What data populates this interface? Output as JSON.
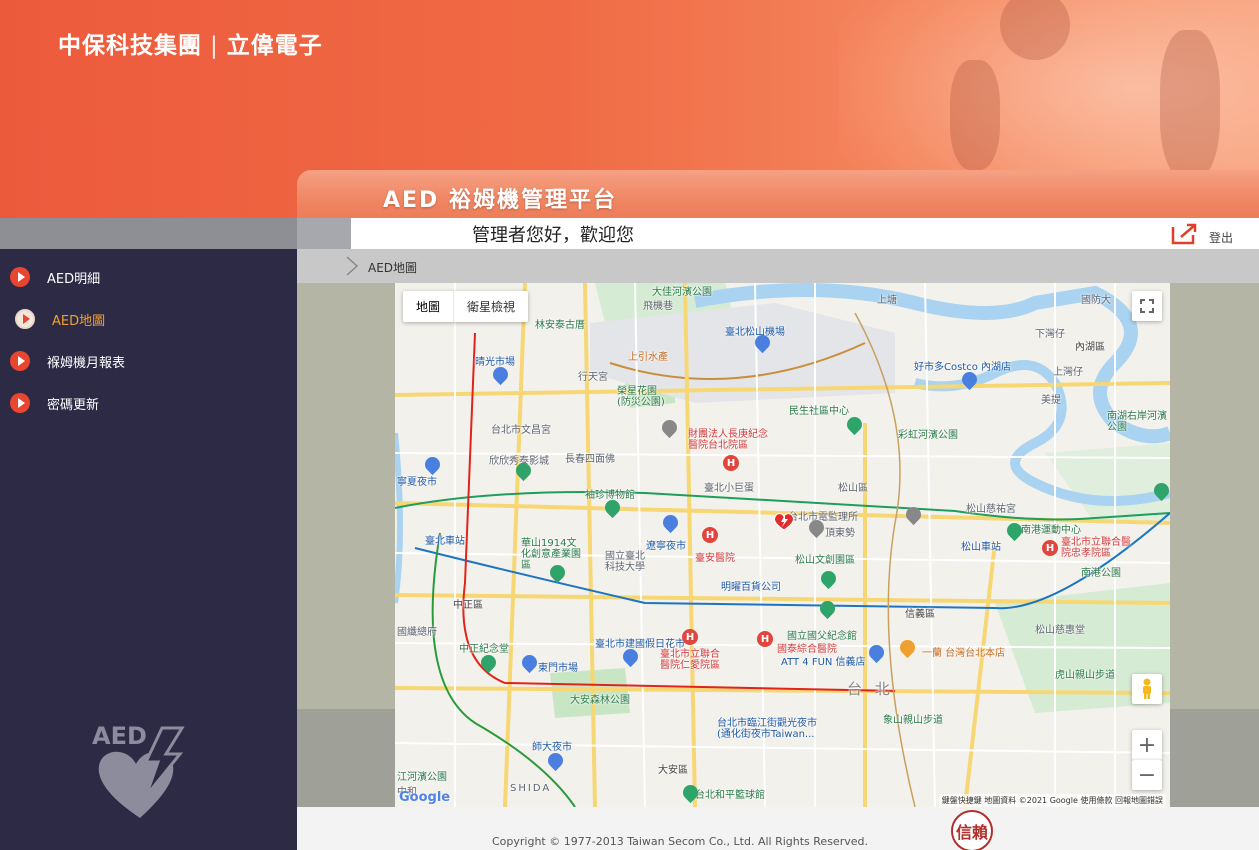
{
  "header": {
    "brand_left": "中保科技集團",
    "brand_sep": "|",
    "brand_right": "立偉電子",
    "platform_title": "AED 裕姆機管理平台"
  },
  "topbar": {
    "welcome": "管理者您好，歡迎您",
    "logout": "登出"
  },
  "breadcrumb": "AED地圖",
  "sidebar": {
    "items": [
      {
        "label": "AED明細",
        "active": false
      },
      {
        "label": "AED地圖",
        "active": true
      },
      {
        "label": "褓姆機月報表",
        "active": false
      },
      {
        "label": "密碼更新",
        "active": false
      }
    ],
    "logo_text": "AED"
  },
  "map": {
    "type_map": "地圖",
    "type_satellite": "衛星檢視",
    "zoom_in": "+",
    "zoom_out": "−",
    "google": "Google",
    "attribution": "鍵盤快捷鍵  地圖資料 ©2021 Google  使用條款  回報地圖錯誤",
    "big_label": "台 北",
    "labels": {
      "dajia": "大佳河濱公園",
      "feiji": "飛機巷",
      "airport": "臺北松山機場",
      "shangtang": "上塘",
      "guomin": "國防大",
      "xiatang": "下灣仔",
      "neihu": "內湖區",
      "linan": "林安泰古厝",
      "jinguang": "晴光市場",
      "shangyin": "上引水產",
      "hangtian": "行天宮",
      "rongxing": "榮星花園(防災公園)",
      "minsheng": "民生社區中心",
      "costco": "好市多Costco 內湖店",
      "shanghu": "上灣仔",
      "meiti": "美提",
      "nanhu": "南湖右岸河濱公園",
      "caiyun": "彩虹河濱公園",
      "wenchang": "台北市文昌宮",
      "changgeng": "財團法人長庚紀念醫院台北院區",
      "xinxin": "欣欣秀泰影城",
      "changan": "長春四面佛",
      "xiaojudan": "臺北小巨蛋",
      "songshan": "松山區",
      "ciyou": "松山慈祐宮",
      "ningxia": "寧夏夜市",
      "yuzhen": "袖珍博物館",
      "jianguan": "台北市電監理所",
      "dingdongshi": "頂東勢",
      "songshan_station": "松山車站",
      "nanggang": "南港運動中心",
      "lianhe": "臺北市立聯合醫院忠孝院區",
      "huashan": "華山1914文化創意產業園區",
      "liaoning": "遼寧夜市",
      "taipei_station": "臺北車站",
      "keji": "國立臺北科技大學",
      "kaiyi": "臺安醫院",
      "songwen": "松山文創園區",
      "nanggang_park": "南港公園",
      "mingyao": "明曜百貨公司",
      "zhongzheng": "中正區",
      "guofu": "國立國父紀念館",
      "jianguo": "臺北市建國假日花市",
      "guotai": "國泰綜合醫院",
      "yilan": "一蘭 台灣台北本店",
      "att": "ATT 4 FUN 信義店",
      "songshan_cihui": "松山慈惠堂",
      "zhongzheng_memorial": "中正紀念堂",
      "dongmen": "東門市場",
      "renai": "臺北市立聯合醫院仁愛院區",
      "hushan": "虎山親山步道",
      "daan_park": "大安森林公園",
      "xiangshan": "象山親山步道",
      "linjiang": "台北市臨江街觀光夜市(通化街夜市Taiwan...",
      "shida": "師大夜市",
      "xinyi": "信義區",
      "daan": "大安區",
      "heping": "台北和平籃球館",
      "guting": "國纖總府",
      "shida_en": "SHIDA",
      "zhonghe": "中和",
      "jiang": "江河濱公園"
    }
  },
  "footer": {
    "copyright": "Copyright © 1977-2013 Taiwan Secom Co., Ltd. All Rights Reserved.",
    "seal": "信賴"
  },
  "colors": {
    "header_orange": "#ec5a3c",
    "sidebar_navy": "#2c2a45",
    "active_text": "#f0a030",
    "bullet_red": "#e8462f"
  }
}
